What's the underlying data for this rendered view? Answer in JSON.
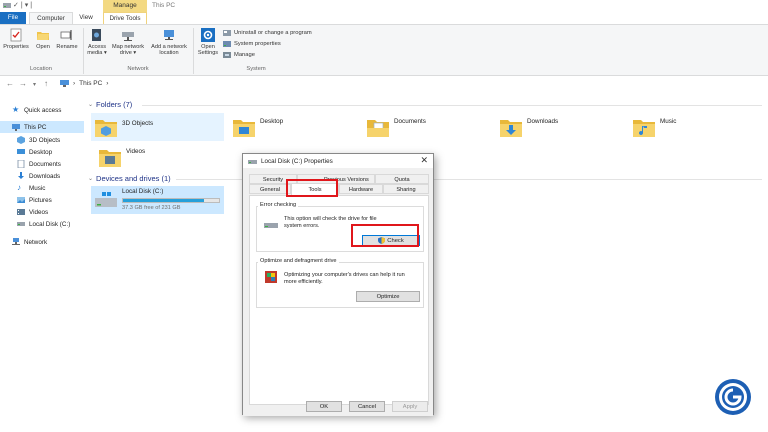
{
  "titlebar": {
    "context_tab": "Manage",
    "window_title": "This PC"
  },
  "ribbon_tabs": {
    "file": "File",
    "computer": "Computer",
    "view": "View",
    "drive_tools": "Drive Tools"
  },
  "ribbon": {
    "location": {
      "label": "Location",
      "buttons": [
        "Properties",
        "Open",
        "Rename"
      ]
    },
    "network": {
      "label": "Network",
      "access_media": [
        "Access",
        "media ▾"
      ],
      "map_network_drive": [
        "Map network",
        "drive ▾"
      ],
      "add_network_location": [
        "Add a network",
        "location"
      ]
    },
    "system": {
      "label": "System",
      "open_settings": [
        "Open",
        "Settings"
      ],
      "uninstall": "Uninstall or change a program",
      "system_properties": "System properties",
      "manage": "Manage"
    }
  },
  "address": {
    "segment": "This PC"
  },
  "sidebar": {
    "items": [
      "Quick access",
      "This PC",
      "3D Objects",
      "Desktop",
      "Documents",
      "Downloads",
      "Music",
      "Pictures",
      "Videos",
      "Local Disk (C:)",
      "Network"
    ]
  },
  "main": {
    "folders_header": "Folders (7)",
    "folders": [
      "3D Objects",
      "Desktop",
      "Documents",
      "Downloads",
      "Music",
      "Videos"
    ],
    "drives_header": "Devices and drives (1)",
    "drive": {
      "name": "Local Disk (C:)",
      "free_text": "37.3 GB free of 231 GB",
      "used_fraction": 0.84
    }
  },
  "dialog": {
    "title": "Local Disk (C:) Properties",
    "tabs_row1": [
      "Security",
      "Previous Versions",
      "Quota"
    ],
    "tabs_row2": [
      "General",
      "Tools",
      "Hardware",
      "Sharing"
    ],
    "error_checking": {
      "legend": "Error checking",
      "desc": [
        "This option will check the drive for file",
        "system errors."
      ],
      "button": "Check"
    },
    "optimize": {
      "legend": "Optimize and defragment drive",
      "desc": [
        "Optimizing your computer's drives can help it run",
        "more efficiently."
      ],
      "button": "Optimize"
    },
    "footer": {
      "ok": "OK",
      "cancel": "Cancel",
      "apply": "Apply"
    }
  },
  "colors": {
    "accent": "#1a6fc2",
    "highlight": "#e0161b",
    "selection": "#cce8ff",
    "logo": "#1d5fb4"
  }
}
